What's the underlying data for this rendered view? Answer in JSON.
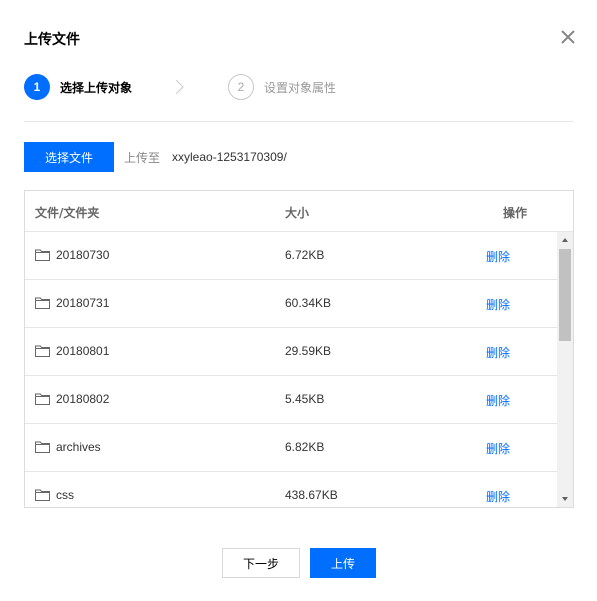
{
  "dialog": {
    "title": "上传文件"
  },
  "steps": [
    {
      "number": "1",
      "label": "选择上传对象",
      "state": "active"
    },
    {
      "number": "2",
      "label": "设置对象属性",
      "state": "inactive"
    }
  ],
  "upload_bar": {
    "select_button_label": "选择文件",
    "upload_to_label": "上传至",
    "upload_path": "xxyleao-1253170309/"
  },
  "table": {
    "columns": [
      "文件/文件夹",
      "大小",
      "操作"
    ],
    "rows": [
      {
        "name": "20180730",
        "size": "6.72KB",
        "action": "删除"
      },
      {
        "name": "20180731",
        "size": "60.34KB",
        "action": "删除"
      },
      {
        "name": "20180801",
        "size": "29.59KB",
        "action": "删除"
      },
      {
        "name": "20180802",
        "size": "5.45KB",
        "action": "删除"
      },
      {
        "name": "archives",
        "size": "6.82KB",
        "action": "删除"
      },
      {
        "name": "css",
        "size": "438.67KB",
        "action": "删除"
      }
    ]
  },
  "footer": {
    "next_label": "下一步",
    "upload_label": "上传"
  },
  "colors": {
    "primary": "#006eff",
    "border": "#dcdcdc",
    "muted_text": "#999999"
  }
}
